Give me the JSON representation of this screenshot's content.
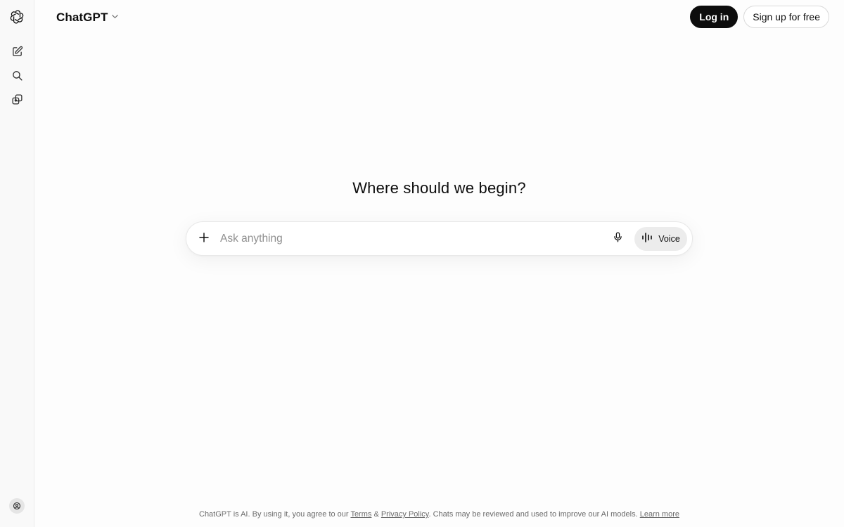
{
  "sidebar": {
    "logo_icon": "openai-logo-icon",
    "items": [
      {
        "icon": "new-chat-icon"
      },
      {
        "icon": "search-icon"
      },
      {
        "icon": "library-icon"
      }
    ],
    "profile_icon": "profile-icon"
  },
  "header": {
    "model_name": "ChatGPT",
    "model_chevron_icon": "chevron-down-icon",
    "login_label": "Log in",
    "signup_label": "Sign up for free"
  },
  "main": {
    "headline": "Where should we begin?",
    "composer": {
      "placeholder": "Ask anything",
      "value": "",
      "plus_icon": "plus-icon",
      "mic_icon": "microphone-icon",
      "voice_icon": "voice-waveform-icon",
      "voice_label": "Voice"
    }
  },
  "footer": {
    "text_before_terms": "ChatGPT is AI. By using it, you agree to our ",
    "terms_label": "Terms",
    "ampersand": " & ",
    "privacy_label": "Privacy Policy",
    "text_after_privacy": ". Chats may be reviewed and used to improve our AI models. ",
    "learn_more_label": "Learn more"
  },
  "colors": {
    "background": "#fdfdfd",
    "sidebar_background": "#f9f9f9",
    "primary_button": "#0d0d0d",
    "voice_button": "#ececec"
  }
}
